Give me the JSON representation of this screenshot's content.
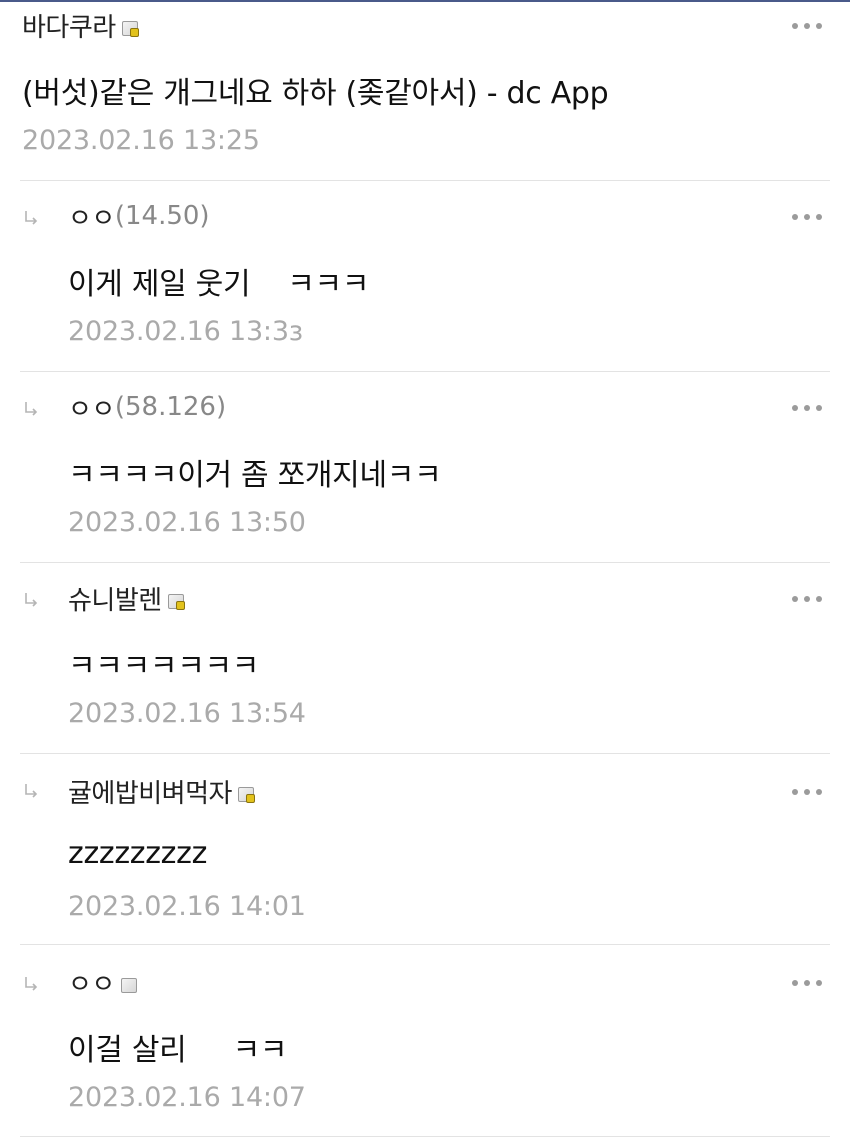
{
  "post": {
    "author": "바다쿠라",
    "body": "(버섯)같은 개그네요 하하 (좆같아서) - dc App",
    "timestamp": "2023.02.16 13:25"
  },
  "replies": [
    {
      "author": "ㅇㅇ",
      "ip": "(14.50)",
      "body": "이게 제일 웃기    ㅋㅋㅋ",
      "timestamp": "2023.02.16 13:3з",
      "badge": "none"
    },
    {
      "author": "ㅇㅇ",
      "ip": "(58.126)",
      "body": "ㅋㅋㅋㅋ이거 좀 쪼개지네ㅋㅋ",
      "timestamp": "2023.02.16 13:50",
      "badge": "none"
    },
    {
      "author": "슈니발렌",
      "ip": "",
      "body": "ㅋㅋㅋㅋㅋㅋㅋ",
      "timestamp": "2023.02.16 13:54",
      "badge": "fixed-nick-icon"
    },
    {
      "author": "귤에밥비벼먹자",
      "ip": "",
      "body": "zzzzzzzzz",
      "timestamp": "2023.02.16 14:01",
      "badge": "fixed-nick-icon"
    },
    {
      "author": "ㅇㅇ",
      "ip": "",
      "body": "이걸 살리     ㅋㅋ",
      "timestamp": "2023.02.16 14:07",
      "badge": "semi-nick-icon"
    }
  ],
  "icons": {
    "reply": "reply-arrow-icon",
    "more": "more-options-icon"
  },
  "colors": {
    "text": "#222222",
    "timestamp": "#aaaaaa",
    "ip": "#888888",
    "divider": "#e3e3e3",
    "more_dots": "#9b9b9b"
  }
}
